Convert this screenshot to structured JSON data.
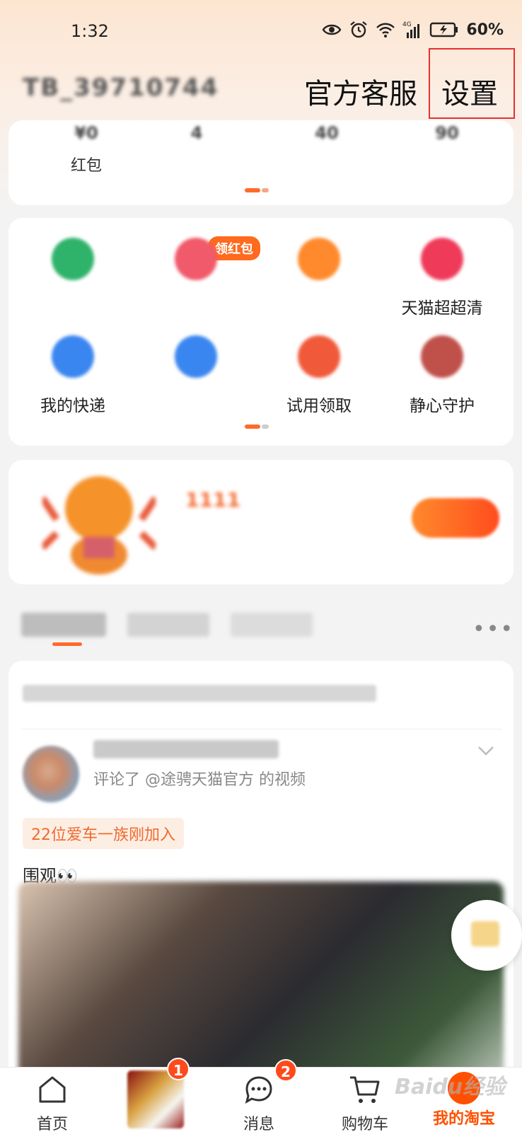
{
  "status_bar": {
    "time": "1:32",
    "battery": "60%",
    "icons": [
      "eye-icon",
      "alarm-icon",
      "wifi-icon",
      "4g-signal-icon",
      "battery-icon"
    ]
  },
  "header": {
    "username": "TB_39710744",
    "service_label": "官方客服",
    "settings_label": "设置"
  },
  "stats": [
    {
      "value": "¥0",
      "label": "红包"
    },
    {
      "value": "4",
      "label": ""
    },
    {
      "value": "40",
      "label": ""
    },
    {
      "value": "90",
      "label": ""
    }
  ],
  "services": {
    "badge": "领红包",
    "items": [
      {
        "label": "",
        "icon": "tree-icon",
        "color": "#2fb36b"
      },
      {
        "label": "",
        "icon": "gift-icon",
        "color": "#f05a6a"
      },
      {
        "label": "",
        "icon": "plus-icon",
        "color": "#ff8a2d"
      },
      {
        "label": "天猫超超清",
        "icon": "hearts-icon",
        "color": "#f03a5a"
      },
      {
        "label": "我的快递",
        "icon": "package-icon",
        "color": "#3a86f0"
      },
      {
        "label": "",
        "icon": "car-icon",
        "color": "#3a86f0"
      },
      {
        "label": "试用领取",
        "icon": "trial-icon",
        "color": "#f05a3a"
      },
      {
        "label": "静心守护",
        "icon": "meditation-icon",
        "color": "#c0504a"
      }
    ]
  },
  "promo": {
    "title": "1111",
    "subtitle": "",
    "button": ""
  },
  "feed_tabs": {
    "items": [
      "",
      "",
      ""
    ],
    "more": "•••"
  },
  "feed": {
    "hint": "",
    "user": "",
    "meta": "评论了 @途骋天猫官方 的视频",
    "fan_badge": "22位爱车一族刚加入",
    "text": "围观👀"
  },
  "bottom_nav": [
    {
      "label": "首页",
      "icon": "home-icon"
    },
    {
      "label": "",
      "icon": "product-thumbnail",
      "badge": "1"
    },
    {
      "label": "消息",
      "icon": "message-icon",
      "badge": "2"
    },
    {
      "label": "购物车",
      "icon": "cart-icon"
    },
    {
      "label": "我的淘宝",
      "icon": "taobao-profile-icon",
      "active": true
    }
  ],
  "watermark": "Baidu经验",
  "colors": {
    "accent": "#ff5000",
    "highlight_box": "#e53030"
  }
}
